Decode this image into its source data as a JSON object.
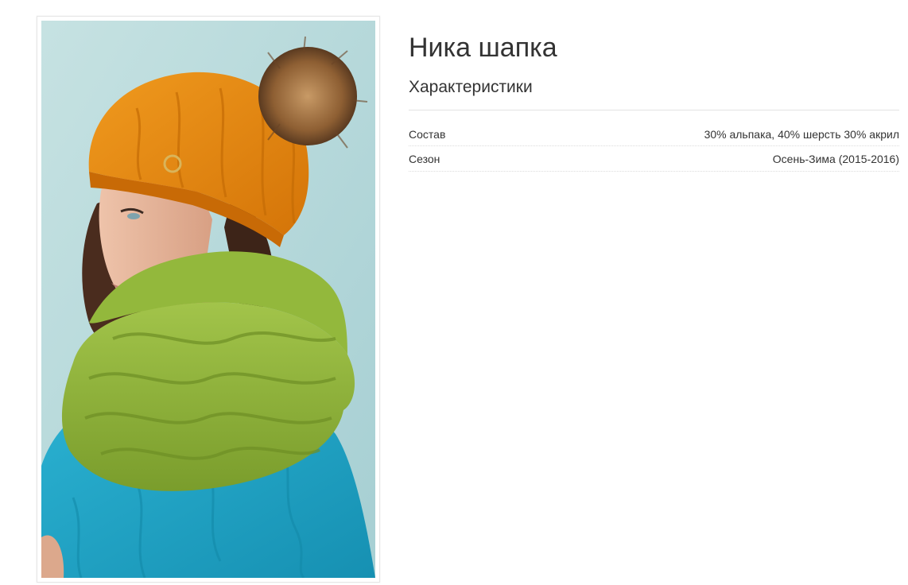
{
  "product": {
    "title": "Ника шапка",
    "photo_alt": "model-wearing-orange-hat-green-snood",
    "characteristics_heading": "Характеристики"
  },
  "specs": [
    {
      "label": "Состав",
      "value": "30% альпака, 40% шерсть 30% акрил"
    },
    {
      "label": "Сезон",
      "value": "Осень-Зима (2015-2016)"
    }
  ],
  "colors": {
    "background_photo": "#b9d8d9",
    "hat": "#e8860f",
    "pompom": "#9a6a3c",
    "snood": "#8fb53a",
    "sweater": "#1fa3c4",
    "hair": "#4a2c1e",
    "skin": "#e6b49a"
  }
}
